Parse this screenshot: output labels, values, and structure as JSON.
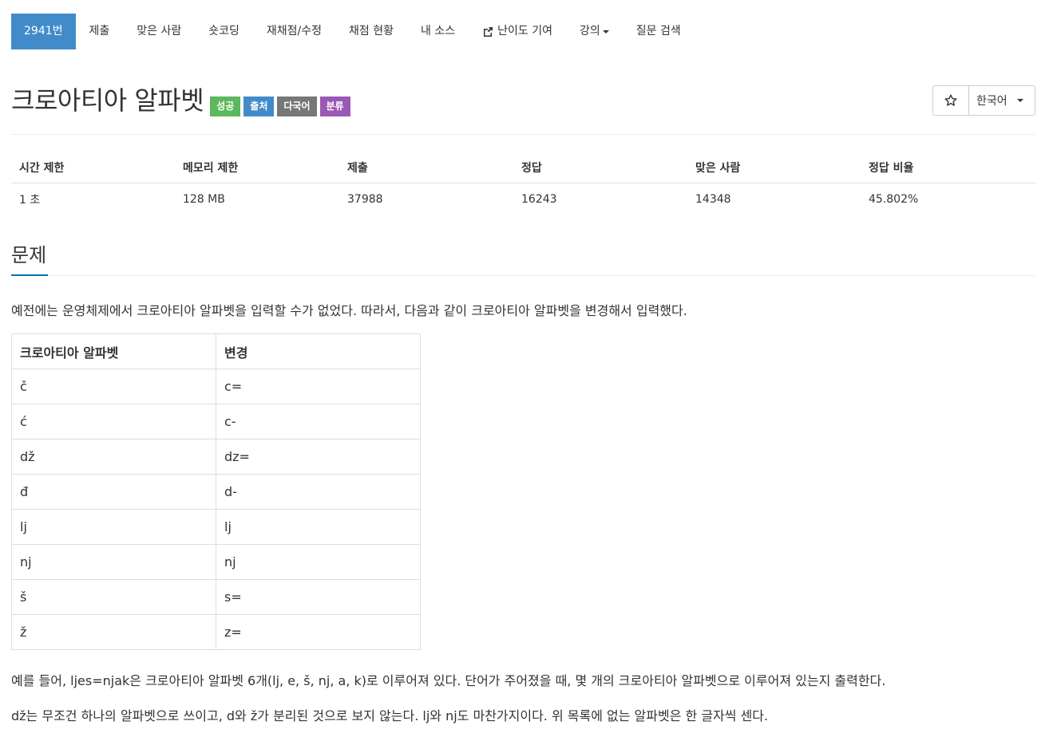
{
  "nav": {
    "items": [
      {
        "label": "2941번",
        "active": true
      },
      {
        "label": "제출"
      },
      {
        "label": "맞은 사람"
      },
      {
        "label": "숏코딩"
      },
      {
        "label": "재채점/수정"
      },
      {
        "label": "채점 현황"
      },
      {
        "label": "내 소스"
      },
      {
        "label": "난이도 기여",
        "icon": "external-link-icon"
      },
      {
        "label": "강의",
        "dropdown": true
      },
      {
        "label": "질문 검색"
      }
    ]
  },
  "problem": {
    "title": "크로아티아 알파벳",
    "badges": [
      {
        "label": "성공",
        "color": "#5cb85c"
      },
      {
        "label": "출처",
        "color": "#428bca"
      },
      {
        "label": "다국어",
        "color": "#777777"
      },
      {
        "label": "분류",
        "color": "#9b59b6"
      }
    ],
    "star_icon": "star-outline-icon",
    "language": "한국어"
  },
  "info": {
    "headers": [
      "시간 제한",
      "메모리 제한",
      "제출",
      "정답",
      "맞은 사람",
      "정답 비율"
    ],
    "values": [
      "1 초",
      "128 MB",
      "37988",
      "16243",
      "14348",
      "45.802%"
    ]
  },
  "section": {
    "title": "문제",
    "intro": "예전에는 운영체제에서 크로아티아 알파벳을 입력할 수가 없었다. 따라서, 다음과 같이 크로아티아 알파벳을 변경해서 입력했다.",
    "table_headers": [
      "크로아티아 알파벳",
      "변경"
    ],
    "table_rows": [
      [
        "č",
        "c="
      ],
      [
        "ć",
        "c-"
      ],
      [
        "dž",
        "dz="
      ],
      [
        "đ",
        "d-"
      ],
      [
        "lj",
        "lj"
      ],
      [
        "nj",
        "nj"
      ],
      [
        "š",
        "s="
      ],
      [
        "ž",
        "z="
      ]
    ],
    "para2": "예를 들어, ljes=njak은 크로아티아 알파벳 6개(lj, e, š, nj, a, k)로 이루어져 있다. 단어가 주어졌을 때, 몇 개의 크로아티아 알파벳으로 이루어져 있는지 출력한다.",
    "para3": "dž는 무조건 하나의 알파벳으로 쓰이고, d와 ž가 분리된 것으로 보지 않는다. lj와 nj도 마찬가지이다. 위 목록에 없는 알파벳은 한 글자씩 센다."
  }
}
